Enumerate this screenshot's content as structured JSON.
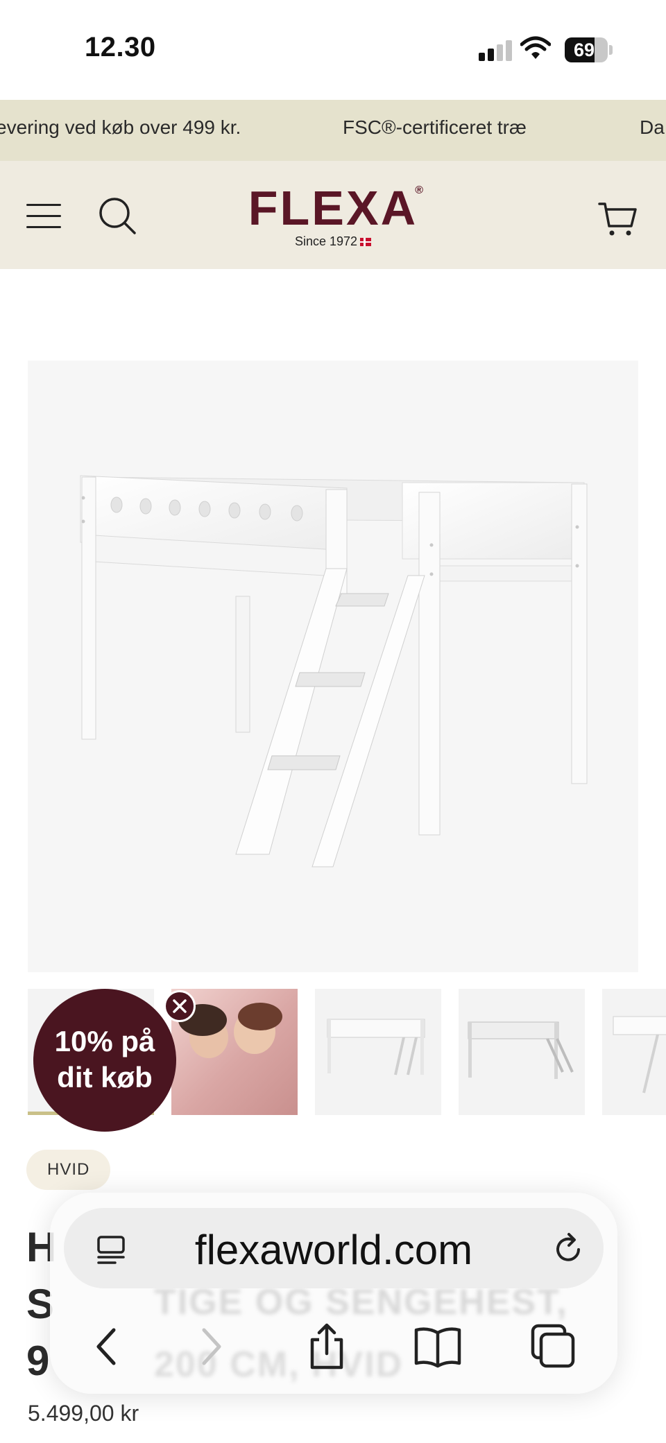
{
  "status_bar": {
    "time": "12.30",
    "battery_level": "69"
  },
  "ticker": {
    "items": [
      "evering ved køb over 499 kr.",
      "FSC®-certificeret træ",
      "Da"
    ]
  },
  "header": {
    "logo_text": "FLEXA",
    "logo_mark": "®",
    "tagline": "Since 1972",
    "icons": [
      "menu-icon",
      "search-icon",
      "cart-icon"
    ]
  },
  "gallery": {
    "thumbnails": [
      "thumb-1",
      "thumb-2",
      "thumb-3",
      "thumb-4",
      "thumb-5"
    ],
    "active_index": 0
  },
  "promo": {
    "line1": "10% på",
    "line2": "dit køb"
  },
  "product": {
    "variant_chip": "HVID",
    "title_line1": "H",
    "title_line2": "S",
    "title_line3": "9",
    "title_obscured_line2": "TIGE OG SENGEHEST,",
    "title_obscured_line3": "200 CM, HVID",
    "price": "5.499,00 kr"
  },
  "browser": {
    "url": "flexaworld.com",
    "toolbar_icons": [
      "back-icon",
      "forward-icon",
      "share-icon",
      "bookmarks-icon",
      "tabs-icon"
    ]
  },
  "colors": {
    "ticker_bg": "#e5e2cd",
    "header_bg": "#efebe0",
    "brand": "#5a1626",
    "promo_bg": "#4a1520",
    "chip_bg": "#f4efe3"
  }
}
